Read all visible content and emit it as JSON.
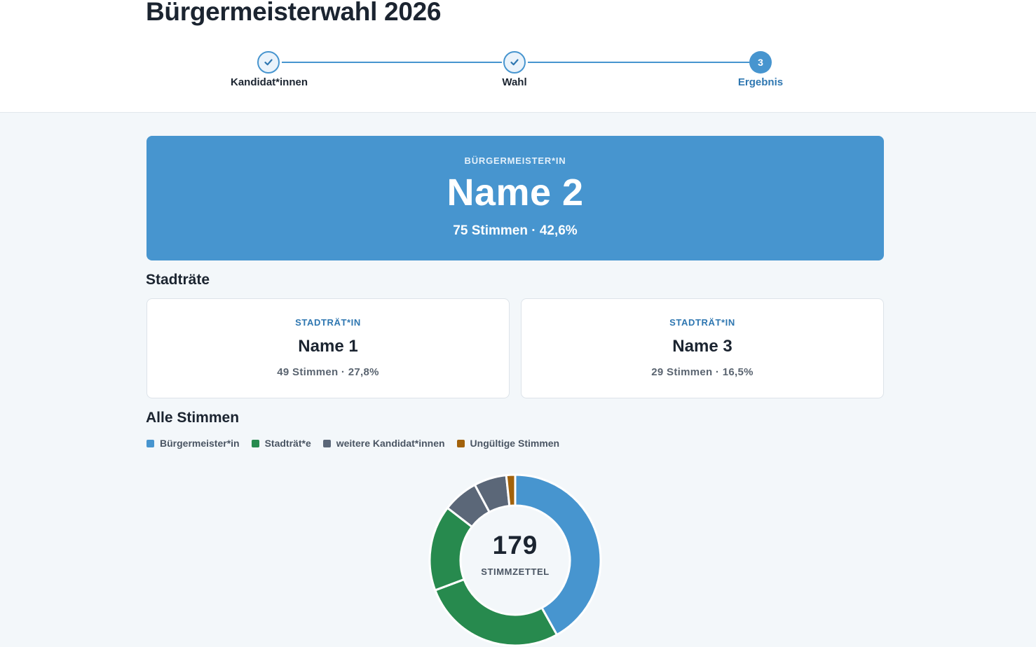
{
  "header": {
    "title": "Bürgermeisterwahl 2026",
    "steps": [
      {
        "label": "Kandidat*innen",
        "status": "done",
        "icon": "check-icon"
      },
      {
        "label": "Wahl",
        "status": "done",
        "icon": "check-icon"
      },
      {
        "label": "Ergebnis",
        "status": "active",
        "number": "3"
      }
    ]
  },
  "winner": {
    "role": "BÜRGERMEISTER*IN",
    "name": "Name 2",
    "stats": "75 Stimmen · 42,6%"
  },
  "council": {
    "title": "Stadträte",
    "members": [
      {
        "role": "STADTRÄT*IN",
        "name": "Name 1",
        "stats": "49 Stimmen · 27,8%"
      },
      {
        "role": "STADTRÄT*IN",
        "name": "Name 3",
        "stats": "29 Stimmen · 16,5%"
      }
    ]
  },
  "all_votes": {
    "title": "Alle Stimmen",
    "legend": [
      {
        "label": "Bürgermeister*in",
        "color": "#4795cf"
      },
      {
        "label": "Stadträt*e",
        "color": "#278a4e"
      },
      {
        "label": "weitere Kandidat*innen",
        "color": "#5b6778"
      },
      {
        "label": "Ungültige Stimmen",
        "color": "#a2620b"
      }
    ],
    "center_value": "179",
    "center_label": "STIMMZETTEL"
  },
  "chart_data": {
    "type": "pie",
    "variant": "donut",
    "total": 179,
    "slices": [
      {
        "category": "Bürgermeister*in",
        "value": 75,
        "color": "#4795cf"
      },
      {
        "category": "Stadträt*e",
        "value": 49,
        "color": "#278a4e"
      },
      {
        "category": "Stadträt*e",
        "value": 29,
        "color": "#278a4e"
      },
      {
        "category": "weitere Kandidat*innen",
        "value": 12,
        "color": "#5b6778"
      },
      {
        "category": "weitere Kandidat*innen",
        "value": 11,
        "color": "#5b6778"
      },
      {
        "category": "Ungültige Stimmen",
        "value": 3,
        "color": "#a2620b"
      }
    ]
  }
}
